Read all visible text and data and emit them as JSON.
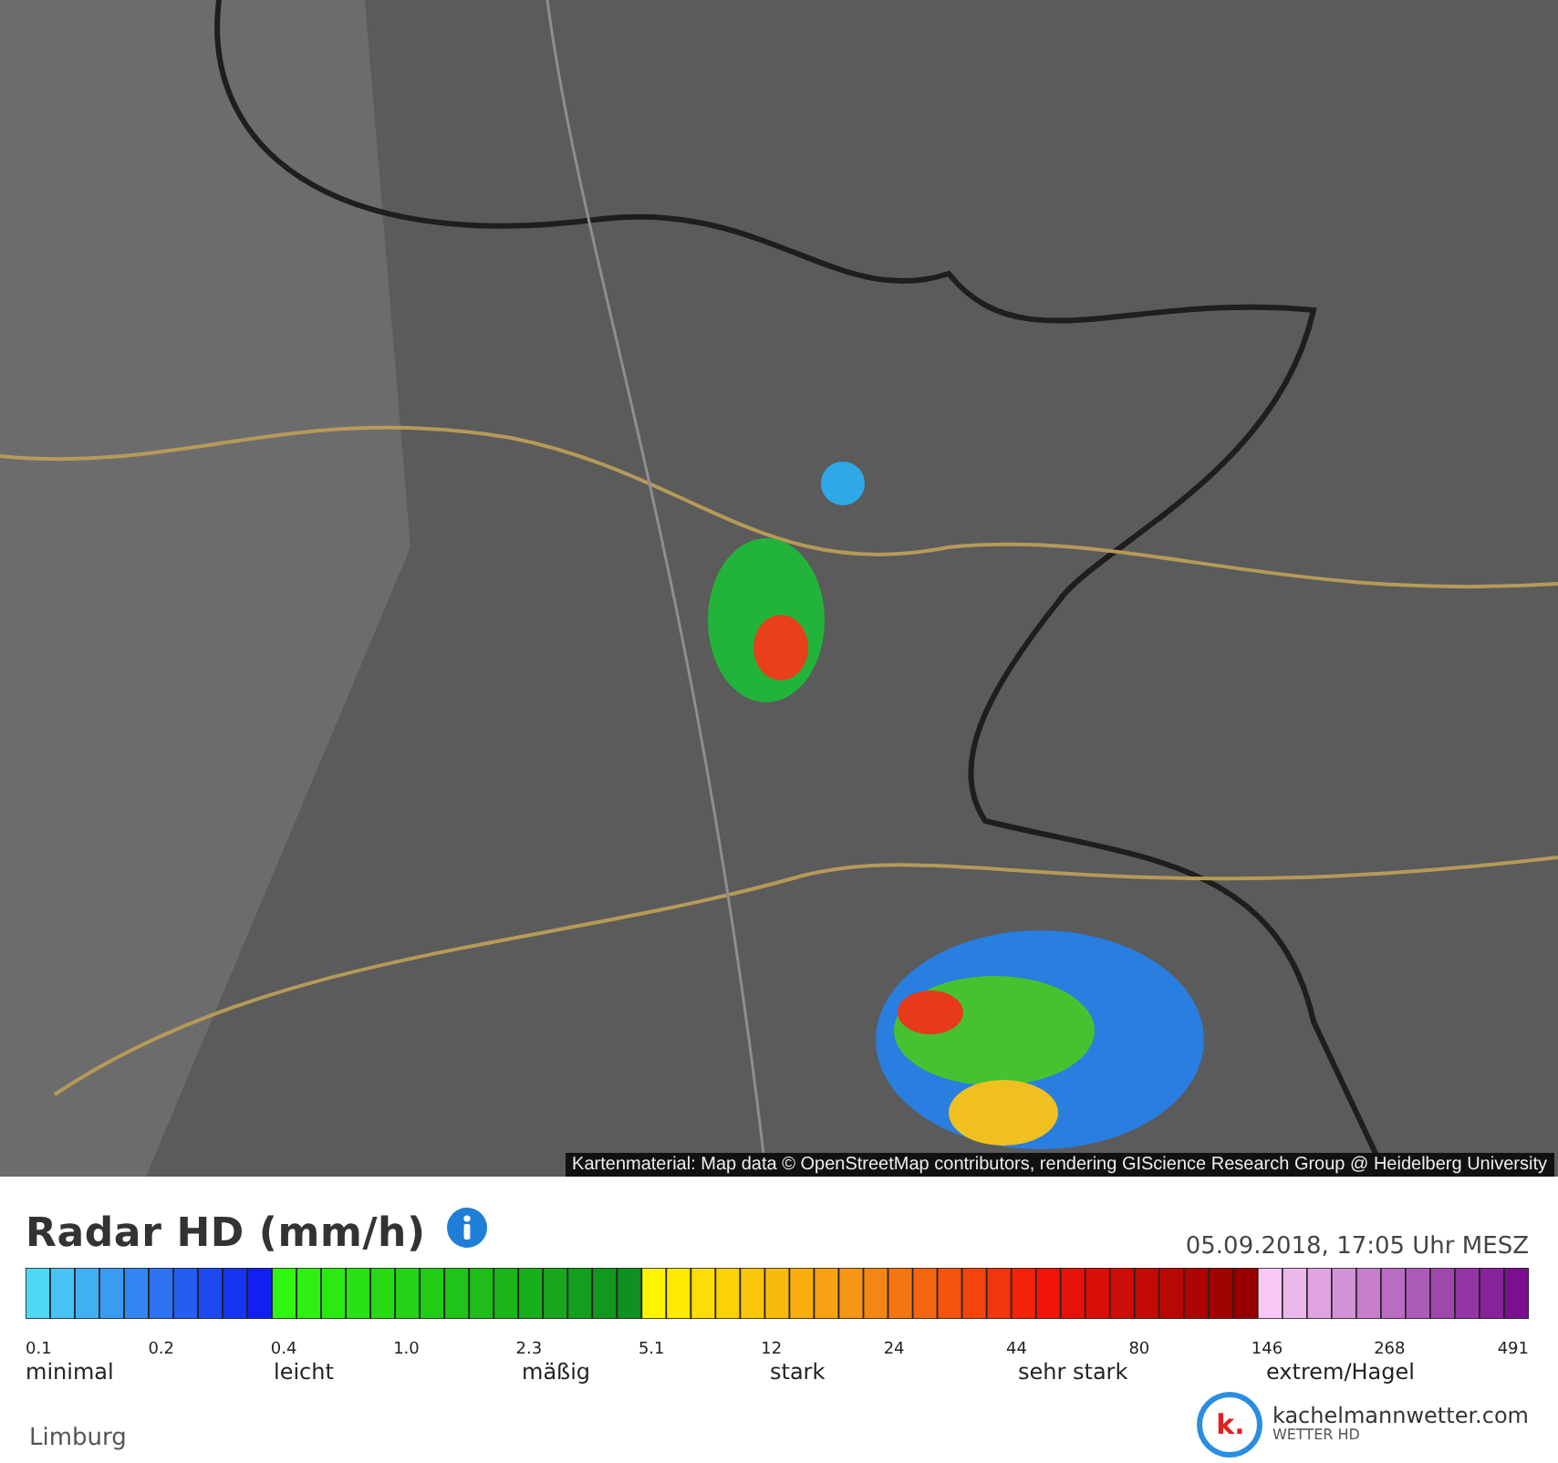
{
  "map": {
    "kind": "picture",
    "attribution": "Kartenmaterial: Map data © OpenStreetMap contributors, rendering GIScience Research Group @ Heidelberg University"
  },
  "legend": {
    "title": "Radar HD (mm/h)",
    "timestamp": "05.09.2018, 17:05 Uhr MESZ",
    "ticks": [
      "0.1",
      "0.2",
      "0.4",
      "1.0",
      "2.3",
      "5.1",
      "12",
      "24",
      "44",
      "80",
      "146",
      "268",
      "491"
    ],
    "categories": [
      "minimal",
      "leicht",
      "mäßig",
      "stark",
      "sehr stark",
      "extrem/Hagel"
    ]
  },
  "region": "Limburg",
  "brand": {
    "mark": "k.",
    "name": "kachelmannwetter.com",
    "tagline": "WETTER HD"
  }
}
